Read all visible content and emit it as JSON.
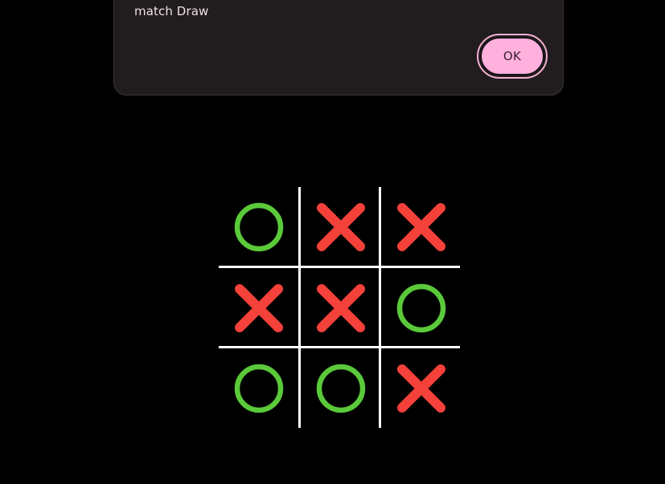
{
  "dialog": {
    "message": "match Draw",
    "ok_label": "OK"
  },
  "board": {
    "cells": [
      "O",
      "X",
      "X",
      "X",
      "X",
      "O",
      "O",
      "O",
      "X"
    ]
  },
  "colors": {
    "background": "#000000",
    "x_mark": "#f4413a",
    "o_mark": "#5ac93a",
    "grid": "#ffffff",
    "dialog_surface": "#211c1e",
    "ok_button": "#ffb0dd"
  },
  "icons": {
    "X": "x-mark-icon",
    "O": "o-mark-icon"
  }
}
